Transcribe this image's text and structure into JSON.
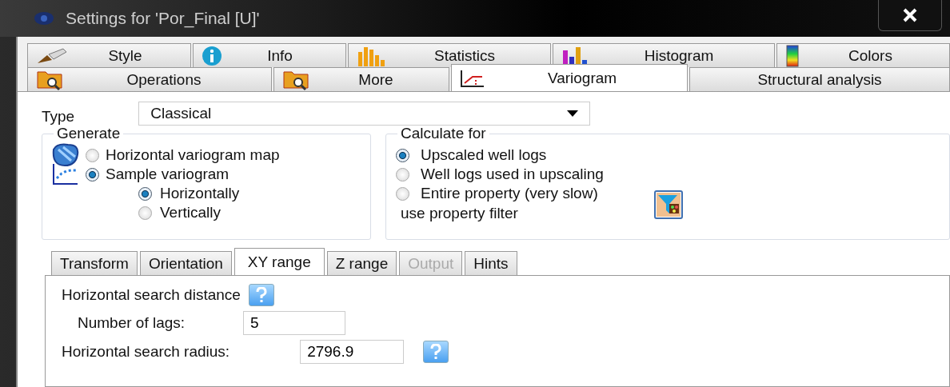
{
  "window": {
    "title": "Settings for 'Por_Final [U]'"
  },
  "tabs_row1": [
    {
      "label": "Style",
      "selected": false
    },
    {
      "label": "Info",
      "selected": false
    },
    {
      "label": "Statistics",
      "selected": false
    },
    {
      "label": "Histogram",
      "selected": false
    },
    {
      "label": "Colors",
      "selected": false
    }
  ],
  "tabs_row2": [
    {
      "label": "Operations",
      "selected": false
    },
    {
      "label": "More",
      "selected": false
    },
    {
      "label": "Variogram",
      "selected": true
    },
    {
      "label": "Structural analysis",
      "selected": false
    }
  ],
  "type": {
    "label": "Type",
    "value": "Classical"
  },
  "generate": {
    "title": "Generate",
    "options": [
      {
        "label": "Horizontal variogram map",
        "selected": false
      },
      {
        "label": "Sample variogram",
        "selected": true,
        "children": [
          {
            "label": "Horizontally",
            "selected": true
          },
          {
            "label": "Vertically",
            "selected": false
          }
        ]
      }
    ]
  },
  "calculate_for": {
    "title": "Calculate for",
    "options": [
      {
        "label": "Upscaled well logs",
        "selected": true
      },
      {
        "label": "Well logs used in upscaling",
        "selected": false
      },
      {
        "label": "Entire property (very slow)",
        "selected": false
      }
    ],
    "filter_label": "use property filter"
  },
  "subtabs": [
    {
      "label": "Transform",
      "selected": false,
      "disabled": false
    },
    {
      "label": "Orientation",
      "selected": false,
      "disabled": false
    },
    {
      "label": "XY range",
      "selected": true,
      "disabled": false
    },
    {
      "label": "Z range",
      "selected": false,
      "disabled": false
    },
    {
      "label": "Output",
      "selected": false,
      "disabled": true
    },
    {
      "label": "Hints",
      "selected": false,
      "disabled": false
    }
  ],
  "xy_range": {
    "heading": "Horizontal search distance",
    "lags_label": "Number of lags:",
    "lags_value": "5",
    "radius_label": "Horizontal search radius:",
    "radius_value": "2796.9"
  }
}
